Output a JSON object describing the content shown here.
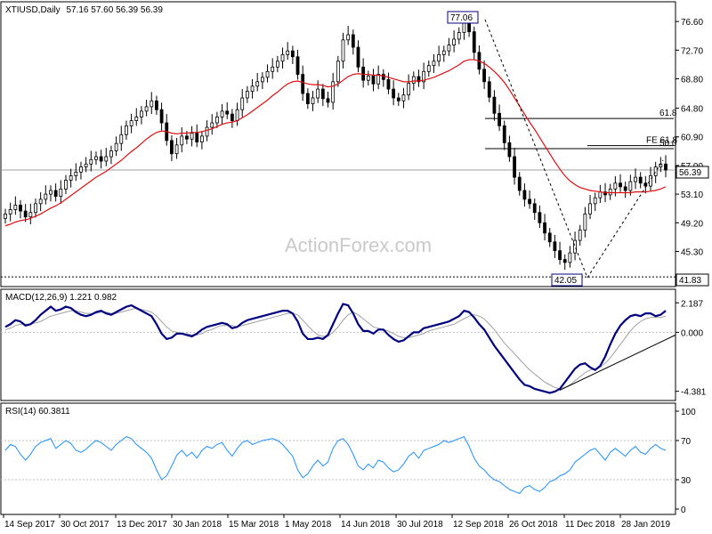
{
  "chart_data": [
    {
      "type": "candlestick",
      "title": "XTIUSD,Daily",
      "ohlc_text": "57.16 57.60 56.39 56.39",
      "watermark": "ActionForex.com",
      "ylim": [
        41.0,
        78.8
      ],
      "y_ticks": [
        "76.60",
        "72.70",
        "68.80",
        "64.80",
        "60.90",
        "57.00",
        "53.10",
        "49.20",
        "45.30"
      ],
      "current_price": "56.39",
      "low_label": "41.83",
      "swing_high": "77.06",
      "swing_low": "42.05",
      "fib_levels": [
        {
          "label": "61.8",
          "value": 63.4
        },
        {
          "label": "FE 61.8",
          "value": 59.7
        },
        {
          "label": "50.0",
          "value": 59.3
        }
      ],
      "ema_color": "#e01010",
      "candle_color": "#000000",
      "close_series": [
        50.4,
        51.0,
        51.6,
        50.8,
        50.0,
        50.6,
        51.8,
        52.4,
        53.1,
        53.6,
        52.8,
        53.8,
        55.0,
        55.6,
        56.1,
        56.8,
        57.2,
        57.8,
        58.2,
        57.6,
        58.2,
        59.0,
        60.0,
        61.2,
        62.4,
        63.1,
        63.6,
        64.4,
        65.0,
        65.8,
        64.6,
        62.8,
        60.4,
        58.6,
        59.8,
        61.0,
        60.6,
        61.4,
        60.2,
        61.0,
        62.2,
        62.8,
        63.6,
        64.4,
        64.0,
        63.1,
        64.6,
        66.2,
        67.1,
        67.8,
        68.4,
        69.0,
        69.8,
        70.4,
        71.2,
        72.1,
        72.6,
        71.8,
        69.4,
        66.8,
        65.4,
        66.2,
        67.4,
        66.1,
        65.6,
        68.4,
        71.2,
        74.1,
        74.8,
        73.1,
        70.4,
        68.6,
        69.2,
        68.1,
        69.4,
        68.7,
        67.4,
        66.2,
        65.8,
        66.6,
        68.2,
        69.1,
        68.4,
        69.8,
        70.6,
        71.2,
        72.1,
        72.6,
        73.4,
        74.2,
        75.1,
        76.4,
        75.2,
        72.4,
        70.1,
        68.4,
        66.3,
        64.1,
        62.4,
        60.1,
        58.2,
        55.4,
        53.6,
        52.4,
        51.8,
        50.6,
        49.2,
        47.8,
        46.6,
        45.4,
        44.2,
        43.8,
        45.1,
        46.8,
        48.2,
        50.4,
        51.8,
        52.6,
        53.4,
        53.0,
        53.8,
        54.6,
        54.1,
        53.6,
        54.8,
        55.4,
        54.6,
        54.2,
        55.6,
        56.8,
        57.2,
        56.39
      ],
      "ema_series": [
        48.8,
        49.0,
        49.3,
        49.5,
        49.6,
        49.8,
        50.1,
        50.4,
        50.8,
        51.2,
        51.5,
        51.9,
        52.4,
        52.9,
        53.4,
        53.9,
        54.4,
        54.9,
        55.4,
        55.8,
        56.2,
        56.7,
        57.2,
        57.7,
        58.3,
        58.9,
        59.4,
        60.0,
        60.6,
        61.1,
        61.5,
        61.7,
        61.6,
        61.4,
        61.3,
        61.4,
        61.4,
        61.5,
        61.5,
        61.6,
        61.8,
        62.0,
        62.3,
        62.6,
        62.8,
        62.9,
        63.1,
        63.5,
        63.9,
        64.4,
        64.9,
        65.4,
        65.9,
        66.5,
        67.0,
        67.6,
        68.1,
        68.4,
        68.5,
        68.3,
        68.1,
        68.0,
        68.0,
        67.9,
        67.7,
        67.8,
        68.1,
        68.6,
        69.1,
        69.4,
        69.5,
        69.4,
        69.4,
        69.3,
        69.3,
        69.2,
        69.0,
        68.8,
        68.6,
        68.4,
        68.4,
        68.5,
        68.5,
        68.6,
        68.8,
        69.0,
        69.3,
        69.6,
        69.9,
        70.3,
        70.7,
        71.2,
        71.4,
        71.4,
        71.2,
        70.9,
        70.4,
        69.8,
        69.1,
        68.3,
        67.3,
        66.2,
        65.1,
        64.0,
        62.9,
        61.9,
        60.8,
        59.7,
        58.6,
        57.5,
        56.5,
        55.6,
        54.9,
        54.4,
        54.0,
        53.8,
        53.6,
        53.5,
        53.4,
        53.3,
        53.3,
        53.3,
        53.3,
        53.3,
        53.3,
        53.4,
        53.4,
        53.4,
        53.5,
        53.6,
        53.8,
        54.1
      ]
    },
    {
      "type": "line",
      "title": "MACD(12,26,9) 1.221 0.982",
      "ylim": [
        -4.8,
        2.6
      ],
      "y_ticks": [
        "2.187",
        "0.000",
        "-4.381"
      ],
      "macd_color": "#000080",
      "signal_color": "#a0a0a0",
      "trendline_color": "#000000",
      "macd_series": [
        0.4,
        0.6,
        0.9,
        0.8,
        0.5,
        0.6,
        0.9,
        1.3,
        1.6,
        1.9,
        1.6,
        1.7,
        1.9,
        1.8,
        1.5,
        1.3,
        1.2,
        1.3,
        1.5,
        1.6,
        1.4,
        1.3,
        1.5,
        1.7,
        1.9,
        2.0,
        1.8,
        1.6,
        1.4,
        1.2,
        0.6,
        -0.1,
        -0.5,
        -0.4,
        -0.1,
        -0.1,
        -0.2,
        -0.3,
        -0.1,
        0.2,
        0.4,
        0.5,
        0.6,
        0.7,
        0.6,
        0.3,
        0.4,
        0.7,
        0.9,
        1.0,
        1.1,
        1.2,
        1.3,
        1.4,
        1.5,
        1.6,
        1.6,
        1.4,
        0.8,
        -0.1,
        -0.5,
        -0.5,
        -0.4,
        -0.5,
        -0.2,
        0.6,
        1.4,
        2.1,
        2.0,
        1.4,
        0.6,
        0.1,
        0.1,
        -0.1,
        0.2,
        0.2,
        -0.2,
        -0.5,
        -0.7,
        -0.6,
        -0.3,
        0.0,
        0.0,
        0.3,
        0.4,
        0.5,
        0.6,
        0.7,
        0.8,
        1.0,
        1.2,
        1.6,
        1.5,
        1.1,
        0.6,
        0.2,
        -0.4,
        -1.0,
        -1.5,
        -2.0,
        -2.5,
        -3.0,
        -3.5,
        -3.9,
        -4.0,
        -4.2,
        -4.3,
        -4.4,
        -4.5,
        -4.4,
        -4.2,
        -3.7,
        -3.2,
        -2.7,
        -2.4,
        -2.3,
        -2.6,
        -2.8,
        -2.5,
        -1.8,
        -0.9,
        -0.1,
        0.5,
        0.9,
        1.2,
        1.3,
        1.2,
        1.4,
        1.4,
        1.2,
        1.3,
        1.6
      ],
      "signal_series": [
        0.2,
        0.3,
        0.5,
        0.6,
        0.6,
        0.6,
        0.7,
        0.8,
        1.0,
        1.2,
        1.3,
        1.4,
        1.5,
        1.6,
        1.6,
        1.5,
        1.4,
        1.4,
        1.4,
        1.5,
        1.5,
        1.4,
        1.4,
        1.5,
        1.6,
        1.7,
        1.8,
        1.7,
        1.6,
        1.5,
        1.2,
        0.8,
        0.4,
        0.1,
        0.0,
        -0.1,
        -0.1,
        -0.2,
        -0.2,
        -0.1,
        0.1,
        0.2,
        0.4,
        0.5,
        0.5,
        0.5,
        0.4,
        0.5,
        0.6,
        0.7,
        0.8,
        0.9,
        1.0,
        1.1,
        1.2,
        1.3,
        1.4,
        1.4,
        1.3,
        0.9,
        0.5,
        0.1,
        -0.2,
        -0.3,
        -0.3,
        0.0,
        0.4,
        0.9,
        1.3,
        1.5,
        1.3,
        1.0,
        0.7,
        0.4,
        0.3,
        0.2,
        0.1,
        -0.1,
        -0.3,
        -0.4,
        -0.4,
        -0.3,
        -0.2,
        -0.1,
        0.1,
        0.2,
        0.3,
        0.4,
        0.5,
        0.6,
        0.8,
        1.0,
        1.2,
        1.3,
        1.2,
        1.0,
        0.6,
        0.2,
        -0.3,
        -0.8,
        -1.2,
        -1.6,
        -2.0,
        -2.4,
        -2.8,
        -3.1,
        -3.4,
        -3.7,
        -3.9,
        -4.1,
        -4.2,
        -4.1,
        -3.9,
        -3.6,
        -3.3,
        -3.0,
        -2.8,
        -2.7,
        -2.6,
        -2.3,
        -1.9,
        -1.4,
        -0.9,
        -0.4,
        0.1,
        0.5,
        0.8,
        1.0,
        1.1,
        1.1,
        1.1,
        1.2
      ],
      "trendline": {
        "from": [
          110,
          -4.3
        ],
        "to": [
          135,
          -0.2
        ]
      }
    },
    {
      "type": "line",
      "title": "RSI(14) 60.3811",
      "ylim": [
        0,
        100
      ],
      "y_ticks": [
        "100",
        "70",
        "30",
        "0"
      ],
      "levels": [
        70,
        30
      ],
      "line_color": "#1e90ff",
      "rsi_series": [
        60,
        66,
        64,
        56,
        50,
        56,
        64,
        68,
        70,
        72,
        62,
        66,
        70,
        67,
        60,
        58,
        61,
        66,
        70,
        68,
        64,
        60,
        66,
        70,
        74,
        72,
        66,
        62,
        58,
        52,
        40,
        30,
        34,
        44,
        55,
        60,
        54,
        58,
        52,
        60,
        64,
        62,
        66,
        68,
        60,
        54,
        62,
        68,
        70,
        66,
        68,
        70,
        71,
        72,
        70,
        66,
        60,
        54,
        40,
        32,
        36,
        44,
        50,
        44,
        48,
        62,
        70,
        72,
        66,
        56,
        44,
        40,
        46,
        42,
        50,
        48,
        42,
        38,
        40,
        46,
        54,
        58,
        52,
        60,
        62,
        64,
        66,
        70,
        68,
        70,
        72,
        74,
        64,
        52,
        44,
        40,
        34,
        30,
        28,
        24,
        20,
        18,
        16,
        22,
        24,
        20,
        18,
        22,
        28,
        30,
        34,
        36,
        40,
        48,
        52,
        56,
        60,
        62,
        56,
        50,
        58,
        62,
        58,
        54,
        60,
        64,
        58,
        56,
        62,
        66,
        62,
        60
      ]
    }
  ],
  "x_axis": {
    "labels": [
      "14 Sep 2017",
      "30 Oct 2017",
      "13 Dec 2017",
      "30 Jan 2018",
      "15 Mar 2018",
      "1 May 2018",
      "14 Jun 2018",
      "30 Jul 2018",
      "12 Sep 2018",
      "26 Oct 2018",
      "11 Dec 2018",
      "28 Jan 2019"
    ]
  }
}
